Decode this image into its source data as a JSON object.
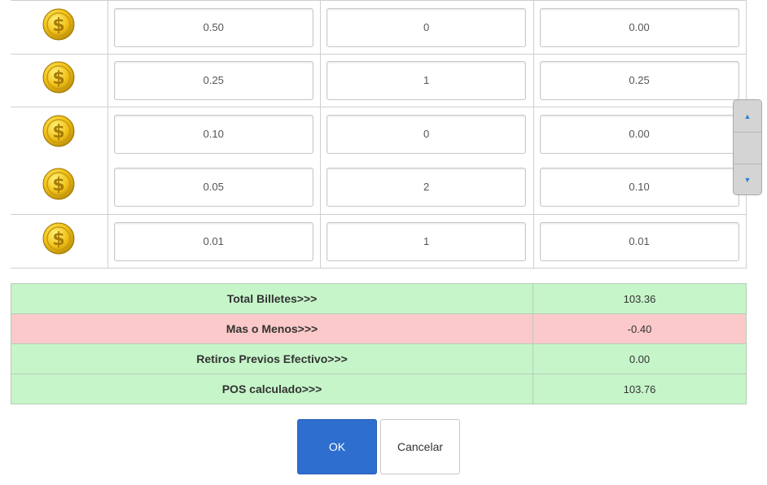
{
  "coins": [
    {
      "icon": "gold-coin-dollar-icon",
      "denomination": "0.50",
      "quantity": "0",
      "total": "0.00"
    },
    {
      "icon": "gold-coin-dollar-icon",
      "denomination": "0.25",
      "quantity": "1",
      "total": "0.25"
    },
    {
      "icon": "gold-coin-dollar-icon",
      "denomination": "0.10",
      "quantity": "0",
      "total": "0.00"
    },
    {
      "icon": "gold-coin-dollar-icon",
      "denomination": "0.05",
      "quantity": "2",
      "total": "0.10"
    },
    {
      "icon": "gold-coin-dollar-icon",
      "denomination": "0.01",
      "quantity": "1",
      "total": "0.01"
    }
  ],
  "scroll": {
    "up_icon": "caret-up-icon",
    "down_icon": "caret-down-icon",
    "up_glyph": "▲",
    "down_glyph": "▼"
  },
  "summary": [
    {
      "label": "Total Billetes>>>",
      "value": "103.36",
      "status": "ok"
    },
    {
      "label": "Mas o Menos>>>",
      "value": "-0.40",
      "status": "warning"
    },
    {
      "label": "Retiros Previos Efectivo>>>",
      "value": "0.00",
      "status": "ok"
    },
    {
      "label": "POS calculado>>>",
      "value": "103.76",
      "status": "ok"
    }
  ],
  "colors": {
    "ok_row": "#c6f5c9",
    "warning_row": "#fbc9c9",
    "primary_button": "#2d6ecf",
    "coin_gold": "#f2c21a"
  },
  "buttons": {
    "ok_label": "OK",
    "cancel_label": "Cancelar"
  }
}
